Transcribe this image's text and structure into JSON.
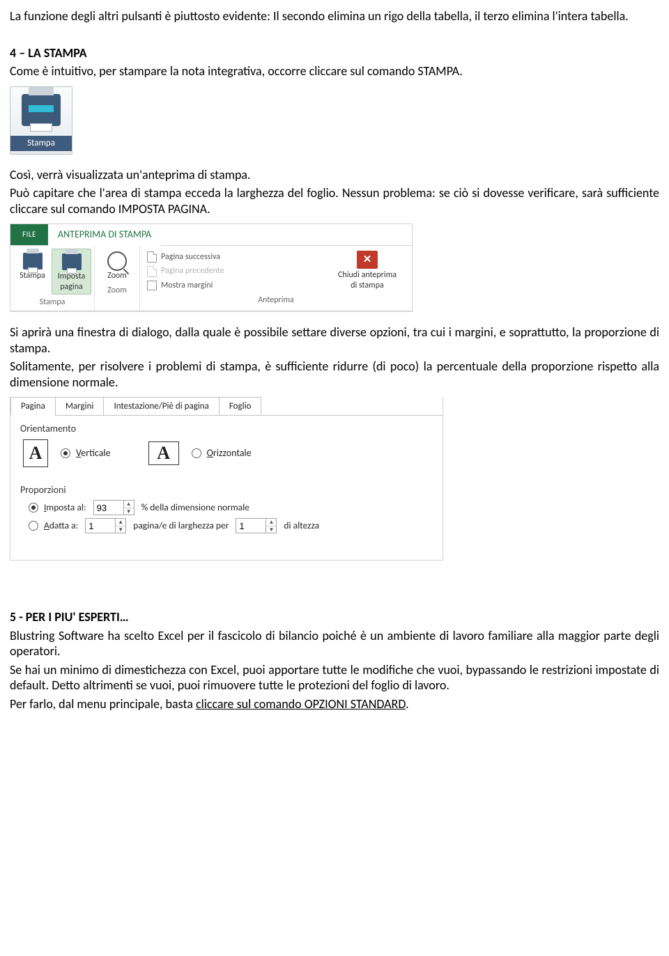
{
  "para": {
    "intro": "La funzione degli altri pulsanti è piuttosto evidente: Il secondo elimina un rigo della tabella, il terzo elimina l'intera tabella.",
    "sec4_title": "4 – LA STAMPA",
    "sec4_p1": "Come è intuitivo, per stampare la nota integrativa, occorre cliccare sul comando STAMPA.",
    "sec4_p2": "Così, verrà visualizzata un'anteprima di stampa.",
    "sec4_p3": "Può capitare che l'area di stampa ecceda la larghezza del foglio. Nessun problema: se ciò si dovesse verificare, sarà sufficiente cliccare sul comando IMPOSTA PAGINA.",
    "sec4_p4": "Si aprirà una finestra di dialogo, dalla quale è possibile settare diverse opzioni, tra cui i margini, e soprattutto, la proporzione di stampa.",
    "sec4_p5": "Solitamente, per risolvere i problemi di stampa, è sufficiente ridurre (di poco) la percentuale della proporzione rispetto alla dimensione normale.",
    "sec5_title": "5  - PER I PIU' ESPERTI…",
    "sec5_p1": "Blustring Software ha scelto Excel per il fascicolo di bilancio poiché è un ambiente di lavoro familiare alla maggior parte degli operatori.",
    "sec5_p2": "Se hai un minimo di dimestichezza con Excel, puoi apportare tutte le modifiche che vuoi, bypassando le restrizioni impostate di default. Detto altrimenti se vuoi, puoi rimuovere tutte le protezioni del foglio di lavoro.",
    "sec5_p3_a": "Per farlo, dal menu principale, basta ",
    "sec5_p3_b": "cliccare sul comando OPZIONI STANDARD",
    "sec5_p3_c": "."
  },
  "stampa_btn_label": "Stampa",
  "ribbon": {
    "tab_file": "FILE",
    "tab_active": "ANTEPRIMA DI STAMPA",
    "stampa": "Stampa",
    "imposta_a": "Imposta",
    "imposta_b": "pagina",
    "zoom": "Zoom",
    "next": "Pagina successiva",
    "prev": "Pagina precedente",
    "margins": "Mostra margini",
    "close_a": "Chiudi anteprima",
    "close_b": "di stampa",
    "grp_stampa": "Stampa",
    "grp_zoom": "Zoom",
    "grp_anteprima": "Anteprima"
  },
  "dlg": {
    "tab_pagina": "Pagina",
    "tab_margini": "Margini",
    "tab_intest": "Intestazione/Piè di pagina",
    "tab_foglio": "Foglio",
    "orient_title": "Orientamento",
    "vert_pre": "V",
    "vert_rest": "erticale",
    "oriz_pre": "O",
    "oriz_rest": "rizzontale",
    "prop_title": "Proporzioni",
    "imposta_pre": "I",
    "imposta_rest": "mposta al:",
    "imposta_val": "93",
    "imposta_suffix": "% della dimensione normale",
    "adatta_pre": "A",
    "adatta_rest": "datta a:",
    "adatta_w": "1",
    "adatta_mid": "pagina/e di larghezza per",
    "adatta_h": "1",
    "adatta_end": "di altezza"
  }
}
